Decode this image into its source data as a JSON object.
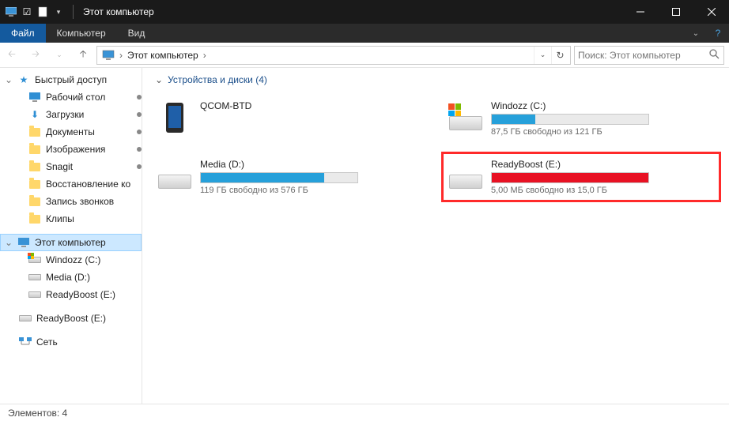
{
  "titlebar": {
    "title": "Этот компьютер"
  },
  "menu": {
    "file": "Файл",
    "computer": "Компьютер",
    "view": "Вид"
  },
  "address": {
    "location": "Этот компьютер"
  },
  "search": {
    "placeholder": "Поиск: Этот компьютер"
  },
  "sidebar": {
    "quick": "Быстрый доступ",
    "items": [
      {
        "label": "Рабочий стол",
        "type": "desktop",
        "pin": true
      },
      {
        "label": "Загрузки",
        "type": "folder",
        "pin": true
      },
      {
        "label": "Документы",
        "type": "folder",
        "pin": true
      },
      {
        "label": "Изображения",
        "type": "folder",
        "pin": true
      },
      {
        "label": "Snagit",
        "type": "folder",
        "pin": true
      },
      {
        "label": "Восстановление ко",
        "type": "folder",
        "pin": false
      },
      {
        "label": "Запись звонков",
        "type": "folder",
        "pin": false
      },
      {
        "label": "Клипы",
        "type": "folder",
        "pin": false
      }
    ],
    "thispc": "Этот компьютер",
    "drives": [
      {
        "label": "Windozz (C:)"
      },
      {
        "label": "Media (D:)"
      },
      {
        "label": "ReadyBoost (E:)"
      }
    ],
    "rb2": "ReadyBoost (E:)",
    "network": "Сеть"
  },
  "section": {
    "title": "Устройства и диски (4)"
  },
  "devices": [
    {
      "name": "QCOM-BTD",
      "kind": "phone",
      "bar": null,
      "stat": ""
    },
    {
      "name": "Windozz (C:)",
      "kind": "os",
      "bar": {
        "pct": 28,
        "color": "blue"
      },
      "stat": "87,5 ГБ свободно из 121 ГБ"
    },
    {
      "name": "Media (D:)",
      "kind": "hdd",
      "bar": {
        "pct": 79,
        "color": "blue"
      },
      "stat": "119 ГБ свободно из 576 ГБ"
    },
    {
      "name": "ReadyBoost (E:)",
      "kind": "hdd",
      "bar": {
        "pct": 100,
        "color": "red"
      },
      "stat": "5,00 МБ свободно из 15,0 ГБ",
      "highlight": true
    }
  ],
  "status": {
    "text": "Элементов: 4"
  }
}
